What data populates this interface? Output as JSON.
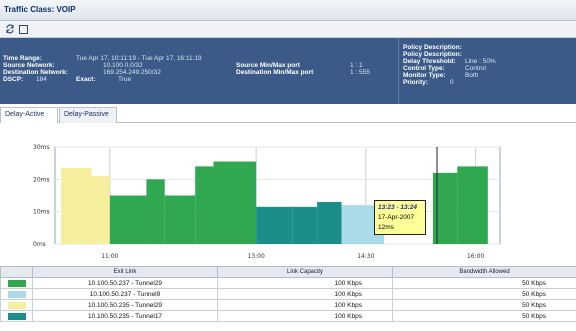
{
  "title": "Traffic Class: VOIP",
  "toolbar": {
    "refresh_icon": "refresh-arrows",
    "window_icon": "window-square"
  },
  "info": {
    "time_range_label": "Time Range:",
    "time_range_value": "Tue Apr 17, 10:11:19 - Tue Apr 17, 16:11:19",
    "source_network_label": "Source Network:",
    "source_network_value": "10.100.0.0/32",
    "destination_network_label": "Destination Network:",
    "destination_network_value": "169.254.249.250/32",
    "dscp_label": "DSCP:",
    "dscp_value": "184",
    "exact_label": "Exact:",
    "exact_value": "True",
    "source_port_label": "Source Min/Max port",
    "source_port_value": "1 : 1",
    "destination_port_label": "Destination Min/Max port",
    "destination_port_value": "1 : 555",
    "policy_description_label_1": "Policy Description:",
    "policy_description_label_2": "Policy Description:",
    "delay_threshold_label": "Delay Threshold:",
    "delay_threshold_value": "Line : 50%",
    "control_type_label": "Control Type:",
    "control_type_value": "Control",
    "monitor_type_label": "Monitor Type:",
    "monitor_type_value": "Both",
    "priority_label": "Priority:",
    "priority_value": "0"
  },
  "tabs": [
    {
      "label": "Delay-Active",
      "active": true
    },
    {
      "label": "Delay-Passive",
      "active": false
    }
  ],
  "colors": {
    "yellow": "#f6ef9e",
    "green": "#2fa84f",
    "teal": "#1b8e8a",
    "lightblue": "#a9dbe8"
  },
  "chart_data": {
    "type": "bar",
    "y_ticks": [
      "30ms",
      "20ms",
      "10ms",
      "0ms"
    ],
    "ylim": [
      0,
      30
    ],
    "x_ticks": [
      "11:00",
      "13:00",
      "14:30",
      "16:00"
    ],
    "segments": [
      {
        "start": "10:20",
        "end": "10:45",
        "value": 23.5,
        "color": "yellow"
      },
      {
        "start": "10:45",
        "end": "11:00",
        "value": 21,
        "color": "yellow"
      },
      {
        "start": "11:00",
        "end": "11:30",
        "value": 15,
        "color": "green"
      },
      {
        "start": "11:30",
        "end": "11:45",
        "value": 20,
        "color": "green"
      },
      {
        "start": "11:45",
        "end": "12:10",
        "value": 15,
        "color": "green"
      },
      {
        "start": "12:10",
        "end": "12:25",
        "value": 24,
        "color": "green"
      },
      {
        "start": "12:25",
        "end": "13:00",
        "value": 25.5,
        "color": "green"
      },
      {
        "start": "13:00",
        "end": "13:30",
        "value": 11.5,
        "color": "teal"
      },
      {
        "start": "13:30",
        "end": "13:50",
        "value": 11.5,
        "color": "teal"
      },
      {
        "start": "13:50",
        "end": "14:10",
        "value": 13,
        "color": "teal"
      },
      {
        "start": "14:10",
        "end": "14:45",
        "value": 12,
        "color": "lightblue"
      },
      {
        "start": "15:25",
        "end": "15:45",
        "value": 22,
        "color": "green"
      },
      {
        "start": "15:45",
        "end": "16:10",
        "value": 24,
        "color": "green"
      }
    ],
    "tooltip": {
      "time": "13:23 - 13:24",
      "date": "17-Apr-2007",
      "value": "12ms"
    }
  },
  "table": {
    "headers": [
      "",
      "Exit Link",
      "Link Capacity",
      "Bandwidth Allowed"
    ],
    "rows": [
      {
        "color": "green",
        "exit_link": "10.100.50.237 - Tunnel29",
        "capacity": "100 Kbps",
        "allowed": "50 Kbps"
      },
      {
        "color": "lightblue",
        "exit_link": "10.100.50.237 - Tunnel9",
        "capacity": "100 Kbps",
        "allowed": "50 Kbps"
      },
      {
        "color": "yellow",
        "exit_link": "10.100.50.235 - Tunnel29",
        "capacity": "100 Kbps",
        "allowed": "50 Kbps"
      },
      {
        "color": "teal",
        "exit_link": "10.100.50.235 - Tunnel17",
        "capacity": "100 Kbps",
        "allowed": "50 Kbps"
      }
    ]
  }
}
